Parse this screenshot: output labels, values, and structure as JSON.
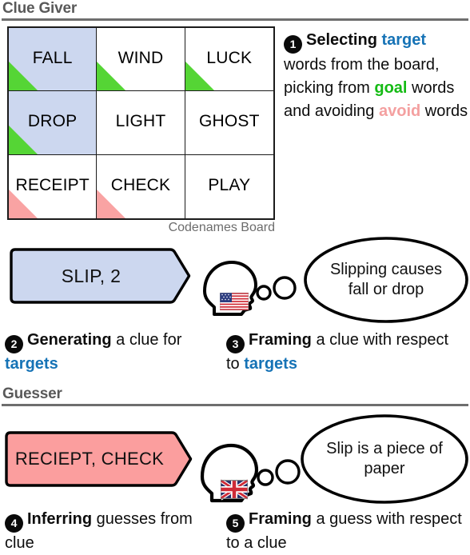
{
  "sections": {
    "clue_giver": {
      "title": "Clue Giver"
    },
    "guesser": {
      "title": "Guesser"
    }
  },
  "board": {
    "caption": "Codenames Board",
    "cells": [
      {
        "word": "FALL",
        "type": "target",
        "marker": "goal"
      },
      {
        "word": "WIND",
        "type": "plain",
        "marker": "goal"
      },
      {
        "word": "LUCK",
        "type": "plain",
        "marker": "goal"
      },
      {
        "word": "DROP",
        "type": "target",
        "marker": "goal"
      },
      {
        "word": "LIGHT",
        "type": "plain",
        "marker": "none"
      },
      {
        "word": "GHOST",
        "type": "plain",
        "marker": "none"
      },
      {
        "word": "RECEIPT",
        "type": "plain",
        "marker": "avoid"
      },
      {
        "word": "CHECK",
        "type": "plain",
        "marker": "avoid"
      },
      {
        "word": "PLAY",
        "type": "plain",
        "marker": "none"
      }
    ]
  },
  "clue": {
    "banner_label": "SLIP, 2",
    "thought": "Slipping causes fall or drop",
    "flag": "us-flag"
  },
  "guess": {
    "banner_label": "RECIEPT, CHECK",
    "thought": "Slip is a piece of paper",
    "flag": "uk-flag"
  },
  "steps": {
    "one": {
      "number": "1",
      "p1": "Selecting",
      "k1": "target",
      "p2": " words from the board, picking from ",
      "k2": "goal",
      "p3": " words and avoiding ",
      "k3": "avoid",
      "p4": " words"
    },
    "two": {
      "number": "2",
      "p1": "Generating",
      "p2": " a clue for ",
      "k1": "targets"
    },
    "three": {
      "number": "3",
      "p1": "Framing",
      "p2": " a clue with respect to ",
      "k1": "targets"
    },
    "four": {
      "number": "4",
      "p1": "Inferring",
      "p2": " guesses from clue"
    },
    "five": {
      "number": "5",
      "p1": "Framing",
      "p2": " a guess with respect to a clue"
    }
  },
  "colors": {
    "target_blue_fill": "#ccd7ef",
    "goal_green": "#55d535",
    "avoid_pink": "#f9a3a3",
    "keyword_blue": "#1673b6",
    "keyword_green": "#15bb15",
    "keyword_pink": "#f4a0a0",
    "header_gray": "#595959"
  }
}
